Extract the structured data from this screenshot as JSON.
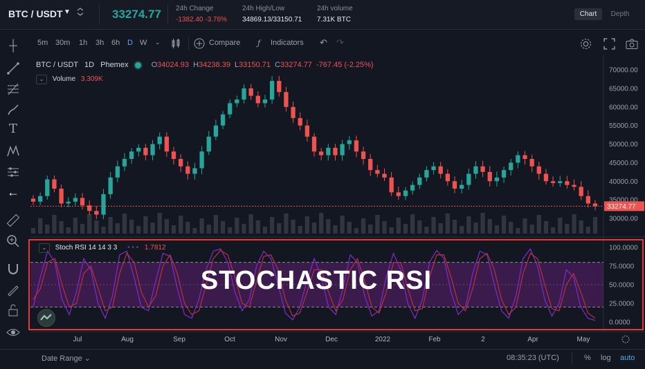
{
  "header": {
    "pair": "BTC / USDT",
    "last_price": "33274.77",
    "change_label": "24h Change",
    "change_value": "-1382.40 -3.76%",
    "highlow_label": "24h High/Low",
    "highlow_value": "34869.13/33150.71",
    "volume_label": "24h volume",
    "volume_value": "7.31K BTC",
    "tab_chart": "Chart",
    "tab_depth": "Depth"
  },
  "toolbar": {
    "intervals": [
      "5m",
      "30m",
      "1h",
      "3h",
      "6h",
      "D",
      "W"
    ],
    "active_interval": "D",
    "compare": "Compare",
    "indicators": "Indicators"
  },
  "legend": {
    "title": "BTC / USDT",
    "interval": "1D",
    "exchange": "Phemex",
    "o_label": "O",
    "o_value": "34024.93",
    "h_label": "H",
    "h_value": "34238.39",
    "l_label": "L",
    "l_value": "33150.71",
    "c_label": "C",
    "c_value": "33274.77",
    "change": "-767.45 (-2.25%)",
    "volume_label": "Volume",
    "volume_value": "3.309K",
    "rsi_label": "Stoch RSI 14 14 3 3",
    "rsi_value": "1.7812"
  },
  "overlay": {
    "text": "STOCHASTIC RSI"
  },
  "bottom": {
    "date_range": "Date Range",
    "time": "08:35:23 (UTC)",
    "percent": "%",
    "log": "log",
    "auto": "auto"
  },
  "colors": {
    "up": "#26a69a",
    "down": "#ef5350",
    "rsi": "#9c27b0",
    "highlight_border": "#e53935"
  },
  "chart_data": [
    {
      "type": "candlestick",
      "title": "BTC / USDT 1D Phemex",
      "ylim": [
        30000,
        70000
      ],
      "y_ticks": [
        "70000.00",
        "65000.00",
        "60000.00",
        "55000.00",
        "50000.00",
        "45000.00",
        "40000.00",
        "35000.00",
        "30000.00"
      ],
      "x_ticks": [
        "Jul",
        "Aug",
        "Sep",
        "Oct",
        "Nov",
        "Dec",
        "2022",
        "Feb",
        "2",
        "Apr",
        "May"
      ],
      "last_price_label": "33274.77",
      "series": [
        {
          "name": "close",
          "values": [
            34500,
            36000,
            40500,
            38000,
            34000,
            34500,
            35500,
            33500,
            32000,
            31000,
            36500,
            41000,
            44000,
            46000,
            48000,
            49000,
            47000,
            50000,
            52000,
            48000,
            46000,
            44000,
            42000,
            43500,
            48000,
            52000,
            55000,
            58000,
            61000,
            62000,
            65000,
            63000,
            61000,
            62000,
            67000,
            64000,
            60000,
            57000,
            55000,
            52000,
            48000,
            47000,
            49000,
            47000,
            50000,
            51000,
            48000,
            46000,
            43000,
            42000,
            41000,
            37000,
            36000,
            37500,
            39000,
            41000,
            43000,
            44000,
            42000,
            40000,
            38000,
            39000,
            42000,
            44000,
            42500,
            40000,
            41000,
            43000,
            45000,
            47000,
            46000,
            44000,
            42000,
            40000,
            39500,
            40000,
            39000,
            38500,
            36000,
            34000,
            33274.77
          ]
        }
      ]
    },
    {
      "type": "line",
      "title": "Stoch RSI 14 14 3 3",
      "ylim": [
        0,
        100
      ],
      "y_ticks": [
        "100.0000",
        "75.0000",
        "50.0000",
        "25.0000",
        "0.0000"
      ],
      "bands": [
        80,
        20
      ],
      "series": [
        {
          "name": "K",
          "values": [
            20,
            60,
            95,
            80,
            30,
            10,
            40,
            85,
            70,
            25,
            5,
            35,
            90,
            95,
            60,
            20,
            15,
            55,
            92,
            88,
            45,
            10,
            5,
            30,
            70,
            95,
            98,
            80,
            40,
            15,
            30,
            75,
            95,
            85,
            50,
            12,
            3,
            20,
            55,
            85,
            60,
            20,
            10,
            45,
            90,
            80,
            35,
            8,
            15,
            60,
            92,
            70,
            25,
            5,
            30,
            80,
            96,
            85,
            40,
            10,
            20,
            65,
            95,
            90,
            50,
            15,
            5,
            35,
            85,
            98,
            75,
            30,
            8,
            25,
            70,
            60,
            20,
            5,
            2
          ]
        },
        {
          "name": "D",
          "values": [
            30,
            45,
            80,
            85,
            50,
            20,
            25,
            65,
            75,
            45,
            15,
            20,
            65,
            92,
            80,
            40,
            20,
            35,
            75,
            90,
            65,
            25,
            10,
            15,
            50,
            85,
            96,
            90,
            60,
            25,
            20,
            55,
            88,
            90,
            70,
            30,
            8,
            12,
            40,
            70,
            70,
            40,
            15,
            30,
            70,
            85,
            55,
            20,
            12,
            40,
            80,
            80,
            45,
            15,
            18,
            60,
            90,
            90,
            60,
            25,
            15,
            45,
            85,
            92,
            70,
            30,
            10,
            20,
            65,
            92,
            85,
            50,
            18,
            15,
            50,
            65,
            40,
            12,
            5
          ]
        }
      ]
    }
  ]
}
